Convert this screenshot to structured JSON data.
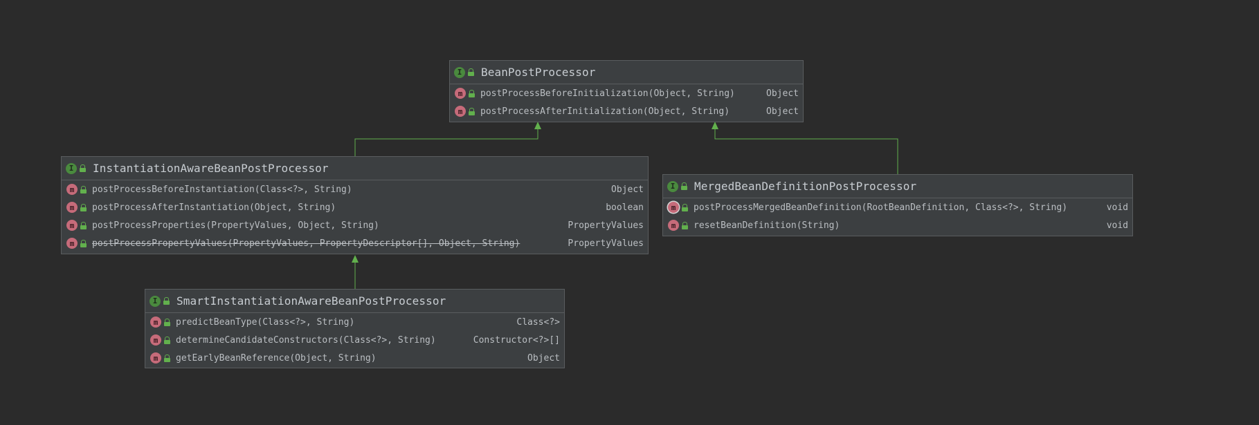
{
  "diagram": {
    "nodes": [
      {
        "id": "bpp",
        "name": "BeanPostProcessor",
        "badge": "I",
        "methods": [
          {
            "signature": "postProcessBeforeInitialization(Object, String)",
            "returns": "Object",
            "deprecated": false,
            "override": false
          },
          {
            "signature": "postProcessAfterInitialization(Object, String)",
            "returns": "Object",
            "deprecated": false,
            "override": false
          }
        ]
      },
      {
        "id": "iabpp",
        "name": "InstantiationAwareBeanPostProcessor",
        "badge": "I",
        "methods": [
          {
            "signature": "postProcessBeforeInstantiation(Class<?>, String)",
            "returns": "Object",
            "deprecated": false,
            "override": false
          },
          {
            "signature": "postProcessAfterInstantiation(Object, String)",
            "returns": "boolean",
            "deprecated": false,
            "override": false
          },
          {
            "signature": "postProcessProperties(PropertyValues, Object, String)",
            "returns": "PropertyValues",
            "deprecated": false,
            "override": false
          },
          {
            "signature": "postProcessPropertyValues(PropertyValues, PropertyDescriptor[], Object, String)",
            "returns": "PropertyValues",
            "deprecated": true,
            "override": false
          }
        ]
      },
      {
        "id": "mbdpp",
        "name": "MergedBeanDefinitionPostProcessor",
        "badge": "I",
        "methods": [
          {
            "signature": "postProcessMergedBeanDefinition(RootBeanDefinition, Class<?>, String)",
            "returns": "void",
            "deprecated": false,
            "override": true
          },
          {
            "signature": "resetBeanDefinition(String)",
            "returns": "void",
            "deprecated": false,
            "override": false
          }
        ]
      },
      {
        "id": "siabpp",
        "name": "SmartInstantiationAwareBeanPostProcessor",
        "badge": "I",
        "methods": [
          {
            "signature": "predictBeanType(Class<?>, String)",
            "returns": "Class<?>",
            "deprecated": false,
            "override": false
          },
          {
            "signature": "determineCandidateConstructors(Class<?>, String)",
            "returns": "Constructor<?>[]",
            "deprecated": false,
            "override": false
          },
          {
            "signature": "getEarlyBeanReference(Object, String)",
            "returns": "Object",
            "deprecated": false,
            "override": false
          }
        ]
      }
    ],
    "edges": [
      {
        "from": "iabpp",
        "to": "bpp",
        "kind": "extends"
      },
      {
        "from": "mbdpp",
        "to": "bpp",
        "kind": "extends"
      },
      {
        "from": "siabpp",
        "to": "iabpp",
        "kind": "extends"
      }
    ],
    "method_badge": "m",
    "colors": {
      "background": "#2b2b2b",
      "node_fill": "#3c3f41",
      "node_border": "#5a5d5f",
      "edge": "#62b04d",
      "interface_badge": "#4a8a3e",
      "method_badge": "#c66b7a",
      "text": "#bbbfc3"
    }
  }
}
